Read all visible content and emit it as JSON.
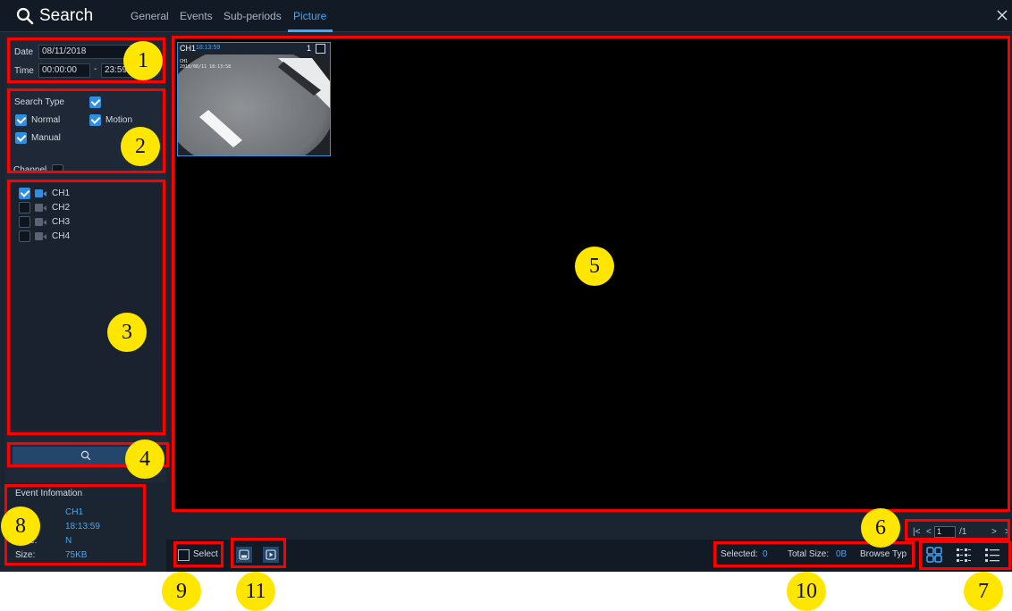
{
  "header": {
    "title": "Search",
    "tabs": [
      {
        "label": "General"
      },
      {
        "label": "Events"
      },
      {
        "label": "Sub-periods"
      },
      {
        "label": "Picture",
        "active": true
      }
    ]
  },
  "search": {
    "date_label": "Date",
    "date_value": "08/11/2018",
    "time_label": "Time",
    "time_start": "00:00:00",
    "time_sep": "-",
    "time_end": "23:59"
  },
  "search_type": {
    "label": "Search Type",
    "all_checked": true,
    "options": [
      {
        "label": "Normal",
        "checked": true
      },
      {
        "label": "Motion",
        "checked": true
      },
      {
        "label": "Manual",
        "checked": true
      }
    ],
    "channel_label": "Channel"
  },
  "channels": [
    {
      "label": "CH1",
      "checked": true
    },
    {
      "label": "CH2",
      "checked": false
    },
    {
      "label": "CH3",
      "checked": false
    },
    {
      "label": "CH4",
      "checked": false
    }
  ],
  "thumbnail": {
    "channel": "CH1",
    "time": "18:13:59",
    "index": "1",
    "osd_channel": "CH1",
    "osd_timestamp": "2018/08/11 18:13:58"
  },
  "pager": {
    "current": "1",
    "total": "/1"
  },
  "info": {
    "title": "Event Infomation",
    "rows": [
      {
        "label": "",
        "value": "CH1"
      },
      {
        "label": "",
        "value": "18:13:59"
      },
      {
        "label": "Type:",
        "value": "N"
      },
      {
        "label": "Size:",
        "value": "75KB"
      }
    ]
  },
  "bottom": {
    "select_label": "Select",
    "selected_label": "Selected:",
    "selected_value": "0",
    "total_size_label": "Total Size:",
    "total_size_value": "0B",
    "browse_type_label": "Browse Typ"
  },
  "annotations": [
    "1",
    "2",
    "3",
    "4",
    "5",
    "6",
    "7",
    "8",
    "9",
    "10",
    "11"
  ],
  "colors": {
    "accent": "#3fa9ff",
    "annotation_box": "#ff0000",
    "annotation_marker": "#ffe600"
  }
}
